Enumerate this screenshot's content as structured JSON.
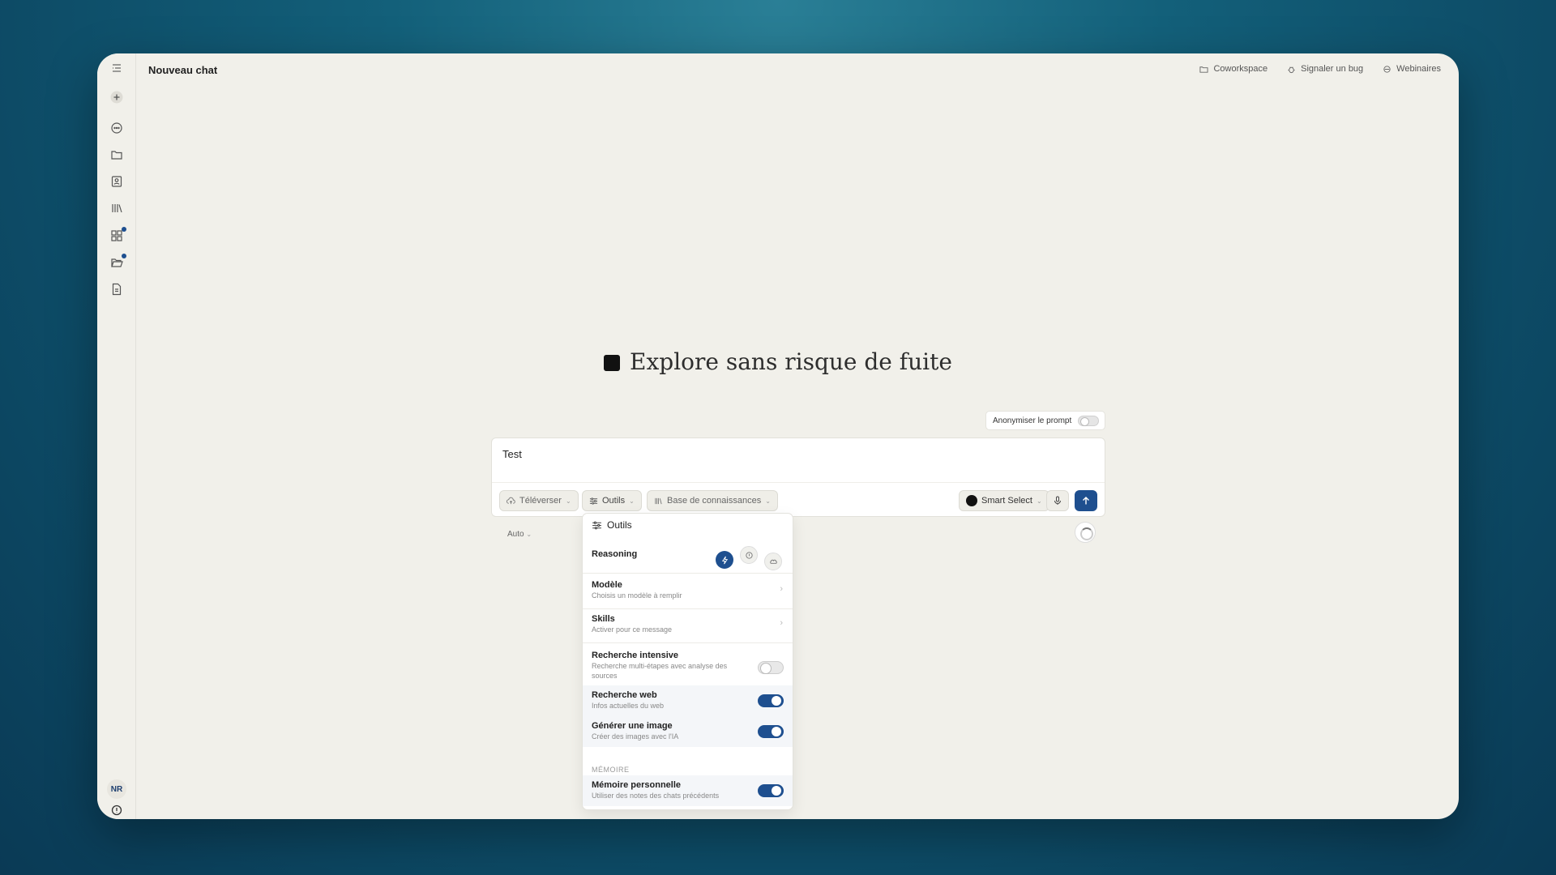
{
  "app": {
    "title": "Nouveau chat",
    "user_initials": "NR"
  },
  "header": {
    "links": [
      {
        "label": "Coworkspace",
        "icon": "folder-icon"
      },
      {
        "label": "Signaler un bug",
        "icon": "bug-icon"
      },
      {
        "label": "Webinaires",
        "icon": "webinar-icon"
      }
    ]
  },
  "sidebar": {
    "items": [
      {
        "icon": "menu-icon"
      },
      {
        "icon": "plus-icon"
      },
      {
        "icon": "chat-icon"
      },
      {
        "icon": "folder-icon"
      },
      {
        "icon": "contacts-icon"
      },
      {
        "icon": "library-icon"
      },
      {
        "icon": "apps-icon",
        "badge": true
      },
      {
        "icon": "open-folder-icon",
        "badge": true
      },
      {
        "icon": "document-icon"
      }
    ],
    "footer_icon": "info-icon"
  },
  "hero": {
    "title": "Explore sans risque de fuite"
  },
  "composer": {
    "anonymize_label": "Anonymiser le prompt",
    "anonymize_enabled": false,
    "text": "Test",
    "buttons": {
      "upload": "Téléverser",
      "tools": "Outils",
      "knowledge": "Base de connaissances",
      "model": "Smart Select"
    },
    "auto_label": "Auto"
  },
  "tools_menu": {
    "title": "Outils",
    "reasoning_label": "Reasoning",
    "rows": [
      {
        "title": "Modèle",
        "subtitle": "Choisis un modèle à remplir"
      },
      {
        "title": "Skills",
        "subtitle": "Activer pour ce message"
      }
    ],
    "toggles": [
      {
        "title": "Recherche intensive",
        "subtitle": "Recherche multi-étapes avec analyse des sources",
        "enabled": false
      },
      {
        "title": "Recherche web",
        "subtitle": "Infos actuelles du web",
        "enabled": true
      },
      {
        "title": "Générer une image",
        "subtitle": "Créer des images avec l'IA",
        "enabled": true
      }
    ],
    "memory_section": "MÉMOIRE",
    "memory": {
      "title": "Mémoire personnelle",
      "subtitle": "Utiliser des notes des chats précédents",
      "enabled": true
    }
  }
}
